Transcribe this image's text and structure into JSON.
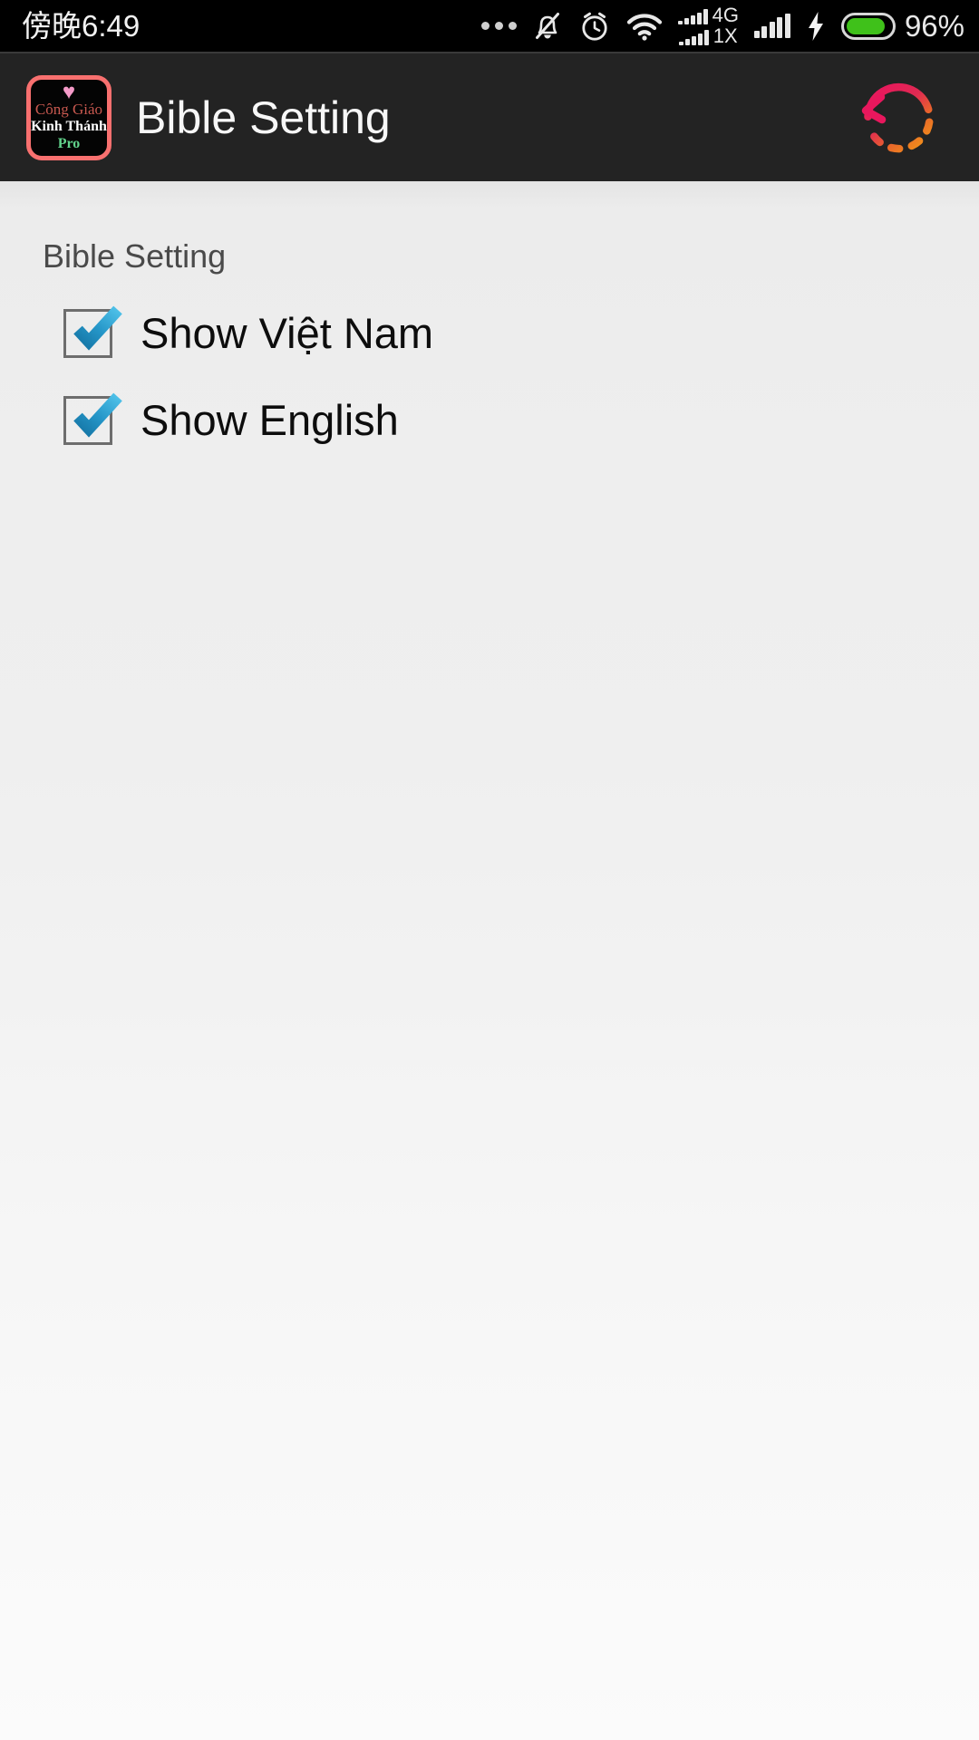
{
  "status_bar": {
    "clock": "傍晚6:49",
    "icons": [
      {
        "name": "more-dots-icon"
      },
      {
        "name": "notifications-muted-icon"
      },
      {
        "name": "alarm-clock-icon"
      },
      {
        "name": "wifi-icon"
      },
      {
        "name": "dual-sim-signal-icon"
      },
      {
        "name": "cellular-signal-icon"
      },
      {
        "name": "charging-bolt-icon"
      },
      {
        "name": "battery-icon"
      }
    ],
    "sim1_label": "4G",
    "sim2_label": "1X",
    "battery_percent": "96%",
    "battery_level": 88,
    "battery_color": "#3fc11a",
    "background_color": "#000000"
  },
  "app_bar": {
    "title": "Bible Setting",
    "background_color": "#232323",
    "icon": {
      "name": "app-logo-icon",
      "heart": "♥",
      "line1": "Công Giáo",
      "line2": "Kinh Thánh",
      "line3": "Pro",
      "border_color": "#f8706f",
      "line1_color": "#c7584f",
      "line3_color": "#62d38c"
    },
    "action": {
      "name": "refresh-button",
      "label": "Refresh",
      "color_start": "#e01a5b",
      "color_end": "#f07f20"
    }
  },
  "content": {
    "section_title": "Bible Setting",
    "preferences": [
      {
        "label": "Show Việt Nam",
        "checked": true
      },
      {
        "label": "Show English",
        "checked": true
      }
    ],
    "checkbox_color": "#2196c8",
    "background_top": "#ececec",
    "background_bottom": "#fbfbfb"
  }
}
